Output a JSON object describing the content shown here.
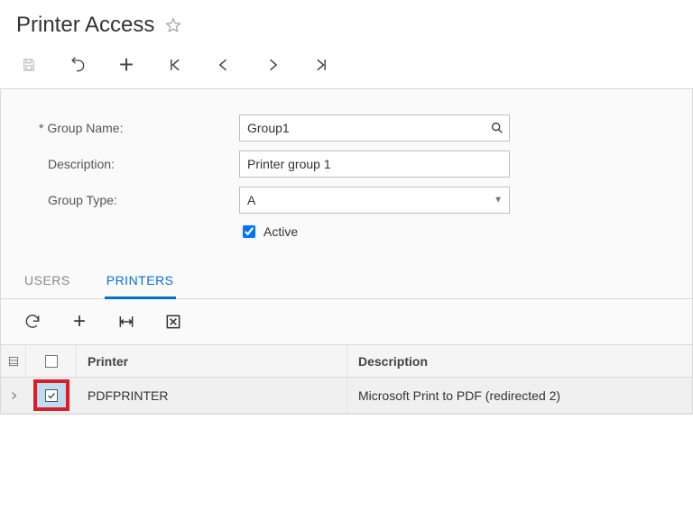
{
  "page": {
    "title": "Printer Access"
  },
  "form": {
    "group_name_label": "Group Name:",
    "group_name_value": "Group1",
    "description_label": "Description:",
    "description_value": "Printer group 1",
    "group_type_label": "Group Type:",
    "group_type_value": "A",
    "active_label": "Active",
    "active_checked": true,
    "required_marker": "*"
  },
  "tabs": {
    "users": "USERS",
    "printers": "PRINTERS"
  },
  "grid": {
    "columns": {
      "printer": "Printer",
      "description": "Description"
    },
    "rows": [
      {
        "printer": "PDFPRINTER",
        "description": "Microsoft Print to PDF (redirected 2)",
        "checked": true
      }
    ]
  }
}
